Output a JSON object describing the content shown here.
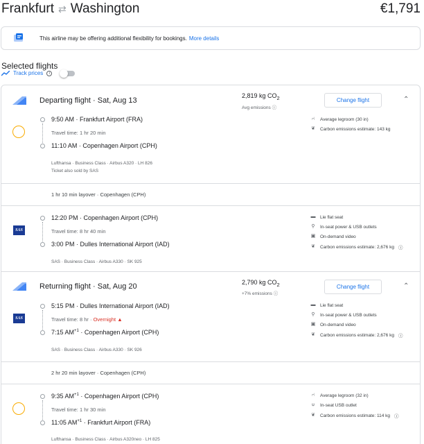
{
  "header": {
    "origin": "Frankfurt",
    "destination": "Washington",
    "price": "€1,791"
  },
  "notice": {
    "text": "This airline may be offering additional flexibility for bookings.",
    "link": "More details"
  },
  "selected": {
    "title": "Selected flights",
    "track_label": "Track prices"
  },
  "depart": {
    "head": "Departing flight",
    "date": "Sat, Aug 13",
    "co2": "2,819 kg CO",
    "co2_sub": "2",
    "co2_note": "Avg emissions",
    "change": "Change flight",
    "seg1": {
      "dep_time": "9:50 AM",
      "dep_airport": "Frankfurt Airport (FRA)",
      "travel": "Travel time: 1 hr 20 min",
      "arr_time": "11:10 AM",
      "arr_airport": "Copenhagen Airport (CPH)",
      "meta": "Lufthansa · Business Class · Airbus A320 · LH 826",
      "meta2": "Ticket also sold by SAS",
      "amenities": [
        "Average legroom (30 in)",
        "Carbon emissions estimate: 143 kg"
      ]
    },
    "layover": "1 hr 10 min layover · Copenhagen (CPH)",
    "seg2": {
      "dep_time": "12:20 PM",
      "dep_airport": "Copenhagen Airport (CPH)",
      "travel": "Travel time: 8 hr 40 min",
      "arr_time": "3:00 PM",
      "arr_airport": "Dulles International Airport (IAD)",
      "meta": "SAS · Business Class · Airbus A330 · SK 925",
      "amenities": [
        "Lie flat seat",
        "In-seat power & USB outlets",
        "On-demand video",
        "Carbon emissions estimate: 2,676 kg"
      ]
    }
  },
  "return": {
    "head": "Returning flight",
    "date": "Sat, Aug 20",
    "co2": "2,790 kg CO",
    "co2_sub": "2",
    "co2_note": "+7% emissions",
    "change": "Change flight",
    "seg1": {
      "dep_time": "5:15 PM",
      "dep_airport": "Dulles International Airport (IAD)",
      "travel": "Travel time: 8 hr",
      "overnight": "Overnight",
      "arr_time": "7:15 AM",
      "arr_sup": "+1",
      "arr_airport": "Copenhagen Airport (CPH)",
      "meta": "SAS · Business Class · Airbus A330 · SK 926",
      "amenities": [
        "Lie flat seat",
        "In-seat power & USB outlets",
        "On-demand video",
        "Carbon emissions estimate: 2,676 kg"
      ]
    },
    "layover": "2 hr 20 min layover · Copenhagen (CPH)",
    "seg2": {
      "dep_time": "9:35 AM",
      "dep_sup": "+1",
      "dep_airport": "Copenhagen Airport (CPH)",
      "travel": "Travel time: 1 hr 30 min",
      "arr_time": "11:05 AM",
      "arr_sup": "+1",
      "arr_airport": "Frankfurt Airport (FRA)",
      "meta": "Lufthansa · Business Class · Airbus A320neo · LH 825",
      "amenities": [
        "Average legroom (32 in)",
        "In-seat USB outlet",
        "Carbon emissions estimate: 114 kg"
      ]
    }
  },
  "icons": {
    "sas_logo": "SAS",
    "accent": "#1a73e8",
    "overnight_color": "#d93025",
    "lufthansa_color": "#f9ab00"
  }
}
